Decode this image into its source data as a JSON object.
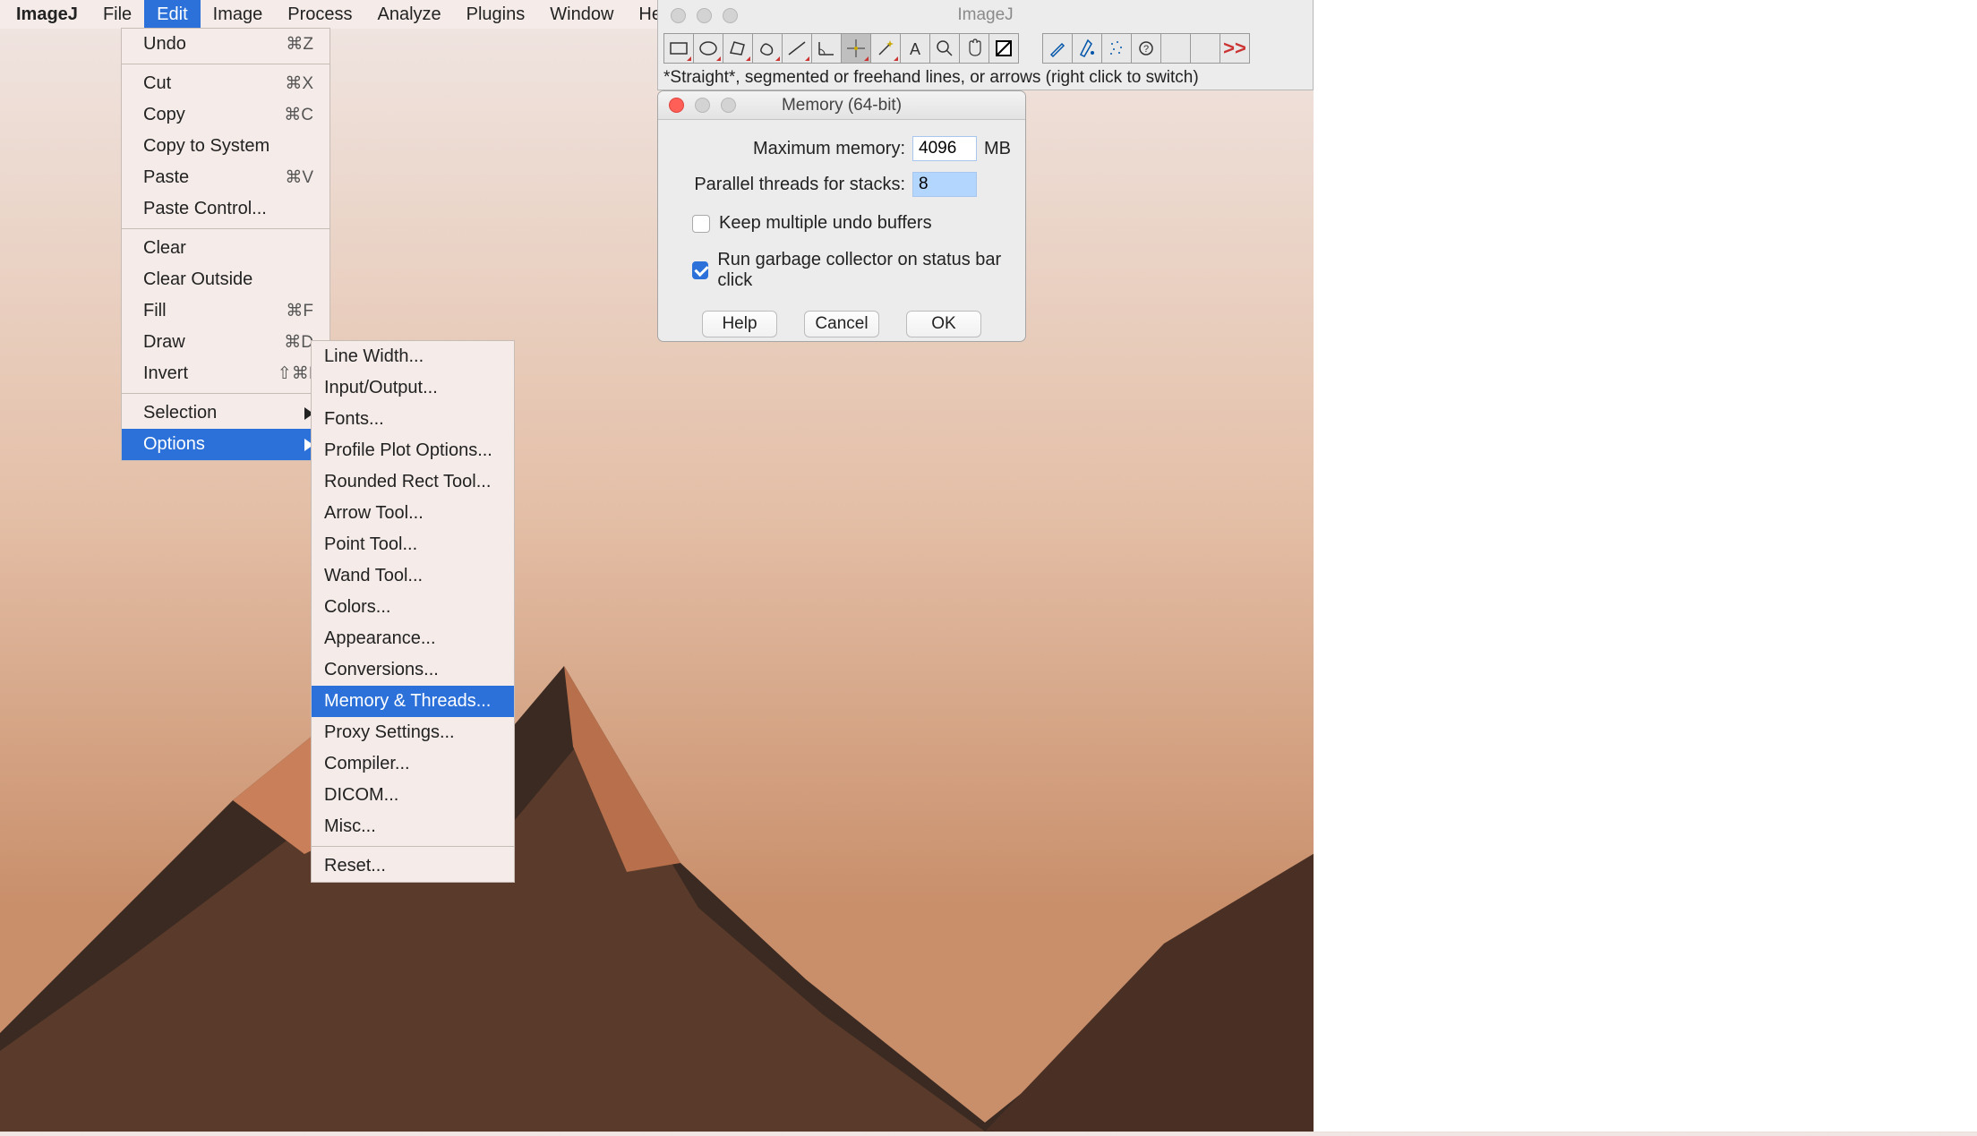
{
  "menubar": {
    "app": "ImageJ",
    "items": [
      "File",
      "Edit",
      "Image",
      "Process",
      "Analyze",
      "Plugins",
      "Window",
      "Help"
    ],
    "highlighted": "Edit"
  },
  "edit_menu": {
    "groups": [
      [
        {
          "label": "Undo",
          "shortcut": "⌘Z"
        }
      ],
      [
        {
          "label": "Cut",
          "shortcut": "⌘X"
        },
        {
          "label": "Copy",
          "shortcut": "⌘C"
        },
        {
          "label": "Copy to System",
          "shortcut": ""
        },
        {
          "label": "Paste",
          "shortcut": "⌘V"
        },
        {
          "label": "Paste Control...",
          "shortcut": ""
        }
      ],
      [
        {
          "label": "Clear",
          "shortcut": ""
        },
        {
          "label": "Clear Outside",
          "shortcut": ""
        },
        {
          "label": "Fill",
          "shortcut": "⌘F"
        },
        {
          "label": "Draw",
          "shortcut": "⌘D"
        },
        {
          "label": "Invert",
          "shortcut": "⇧⌘I"
        }
      ],
      [
        {
          "label": "Selection",
          "submenu": true
        },
        {
          "label": "Options",
          "submenu": true,
          "highlighted": true
        }
      ]
    ]
  },
  "options_menu": {
    "groups": [
      [
        "Line Width...",
        "Input/Output...",
        "Fonts...",
        "Profile Plot Options...",
        "Rounded Rect Tool...",
        "Arrow Tool...",
        "Point Tool...",
        "Wand Tool...",
        "Colors...",
        "Appearance...",
        "Conversions...",
        "Memory & Threads...",
        "Proxy Settings...",
        "Compiler...",
        "DICOM...",
        "Misc..."
      ],
      [
        "Reset..."
      ]
    ],
    "highlighted": "Memory & Threads..."
  },
  "imagej_window": {
    "title": "ImageJ",
    "tools": [
      "rectangle",
      "oval",
      "polygon",
      "freehand",
      "line",
      "angle",
      "point",
      "wand",
      "text",
      "magnifier",
      "hand",
      "picker",
      "",
      "paintbrush",
      "flood",
      "spray",
      "menu",
      "",
      "",
      "more"
    ],
    "selected_tool": "point",
    "status": "*Straight*, segmented or freehand lines, or arrows (right click to switch)",
    "more_glyph": ">>"
  },
  "dialog": {
    "title": "Memory (64-bit)",
    "max_mem_label": "Maximum memory:",
    "max_mem_value": "4096",
    "max_mem_unit": "MB",
    "threads_label": "Parallel threads for stacks:",
    "threads_value": "8",
    "cb1_label": "Keep multiple undo buffers",
    "cb1_checked": false,
    "cb2_label": "Run garbage collector on status bar click",
    "cb2_checked": true,
    "buttons": [
      "Help",
      "Cancel",
      "OK"
    ]
  }
}
